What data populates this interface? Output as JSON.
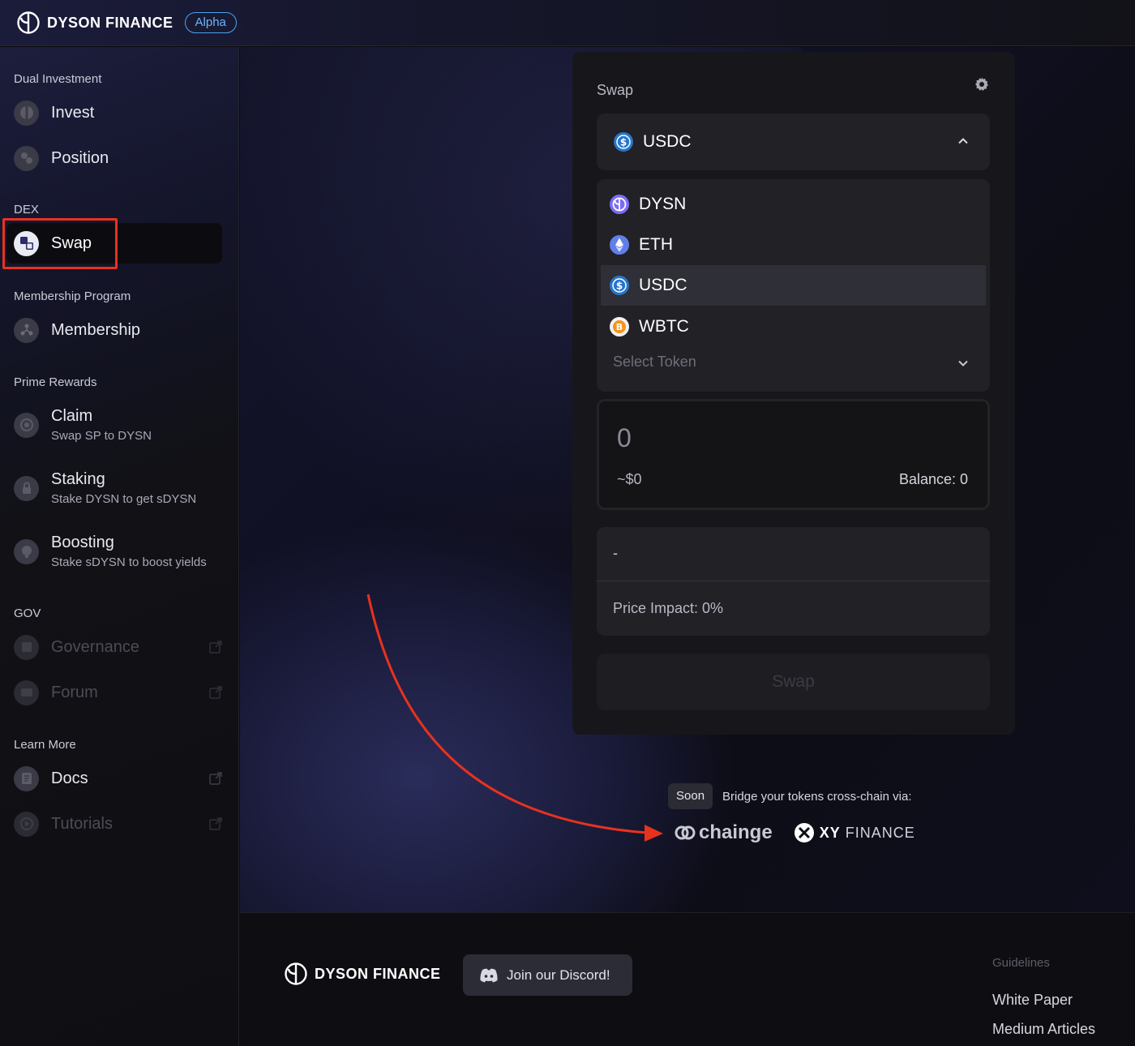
{
  "header": {
    "brand": "DYSON FINANCE",
    "badge": "Alpha"
  },
  "sidebar": {
    "sections": [
      {
        "label": "Dual Investment"
      },
      {
        "label": "DEX"
      },
      {
        "label": "Membership Program"
      },
      {
        "label": "Prime Rewards"
      },
      {
        "label": "GOV"
      },
      {
        "label": "Learn More"
      }
    ],
    "items": {
      "invest": "Invest",
      "position": "Position",
      "swap": "Swap",
      "membership": "Membership",
      "claim": {
        "title": "Claim",
        "subtitle": "Swap SP to DYSN"
      },
      "staking": {
        "title": "Staking",
        "subtitle": "Stake DYSN to get sDYSN"
      },
      "boosting": {
        "title": "Boosting",
        "subtitle": "Stake sDYSN to boost yields"
      },
      "governance": "Governance",
      "forum": "Forum",
      "docs": "Docs",
      "tutorials": "Tutorials"
    }
  },
  "swap": {
    "title": "Swap",
    "selected_token": "USDC",
    "tokens": [
      "DYSN",
      "ETH",
      "USDC",
      "WBTC"
    ],
    "select_placeholder": "Select Token",
    "amount": "0",
    "amount_usd": "~$0",
    "balance": "Balance: 0",
    "info_value": "-",
    "price_impact": "Price Impact: 0%",
    "button": "Swap"
  },
  "bridge": {
    "badge": "Soon",
    "text": "Bridge your tokens cross-chain via:",
    "partner1": "chainge",
    "partner2_bold": "XY",
    "partner2_rest": "FINANCE"
  },
  "footer": {
    "brand": "DYSON FINANCE",
    "discord": "Join our Discord!",
    "guidelines": "Guidelines",
    "links": [
      "White Paper",
      "Medium Articles"
    ]
  },
  "colors": {
    "accent_blue": "#4aa3f0",
    "usdc": "#2775ca",
    "eth": "#627eea",
    "dysn": "#7b6cf6",
    "wbtc": "#f7931a",
    "highlight": "#e8321e"
  }
}
